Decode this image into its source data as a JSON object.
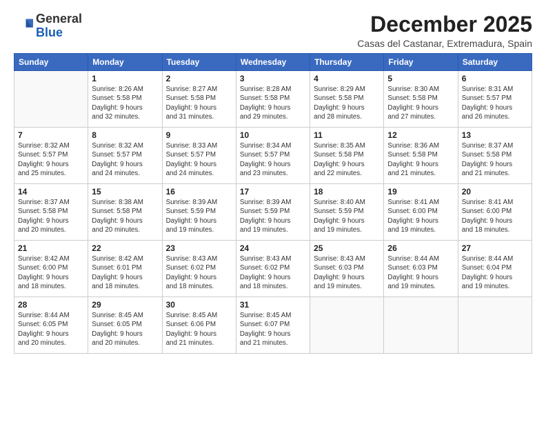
{
  "logo": {
    "line1": "General",
    "line2": "Blue"
  },
  "title": "December 2025",
  "location": "Casas del Castanar, Extremadura, Spain",
  "headers": [
    "Sunday",
    "Monday",
    "Tuesday",
    "Wednesday",
    "Thursday",
    "Friday",
    "Saturday"
  ],
  "weeks": [
    [
      {
        "day": "",
        "info": ""
      },
      {
        "day": "1",
        "info": "Sunrise: 8:26 AM\nSunset: 5:58 PM\nDaylight: 9 hours\nand 32 minutes."
      },
      {
        "day": "2",
        "info": "Sunrise: 8:27 AM\nSunset: 5:58 PM\nDaylight: 9 hours\nand 31 minutes."
      },
      {
        "day": "3",
        "info": "Sunrise: 8:28 AM\nSunset: 5:58 PM\nDaylight: 9 hours\nand 29 minutes."
      },
      {
        "day": "4",
        "info": "Sunrise: 8:29 AM\nSunset: 5:58 PM\nDaylight: 9 hours\nand 28 minutes."
      },
      {
        "day": "5",
        "info": "Sunrise: 8:30 AM\nSunset: 5:58 PM\nDaylight: 9 hours\nand 27 minutes."
      },
      {
        "day": "6",
        "info": "Sunrise: 8:31 AM\nSunset: 5:57 PM\nDaylight: 9 hours\nand 26 minutes."
      }
    ],
    [
      {
        "day": "7",
        "info": "Sunrise: 8:32 AM\nSunset: 5:57 PM\nDaylight: 9 hours\nand 25 minutes."
      },
      {
        "day": "8",
        "info": "Sunrise: 8:32 AM\nSunset: 5:57 PM\nDaylight: 9 hours\nand 24 minutes."
      },
      {
        "day": "9",
        "info": "Sunrise: 8:33 AM\nSunset: 5:57 PM\nDaylight: 9 hours\nand 24 minutes."
      },
      {
        "day": "10",
        "info": "Sunrise: 8:34 AM\nSunset: 5:57 PM\nDaylight: 9 hours\nand 23 minutes."
      },
      {
        "day": "11",
        "info": "Sunrise: 8:35 AM\nSunset: 5:58 PM\nDaylight: 9 hours\nand 22 minutes."
      },
      {
        "day": "12",
        "info": "Sunrise: 8:36 AM\nSunset: 5:58 PM\nDaylight: 9 hours\nand 21 minutes."
      },
      {
        "day": "13",
        "info": "Sunrise: 8:37 AM\nSunset: 5:58 PM\nDaylight: 9 hours\nand 21 minutes."
      }
    ],
    [
      {
        "day": "14",
        "info": "Sunrise: 8:37 AM\nSunset: 5:58 PM\nDaylight: 9 hours\nand 20 minutes."
      },
      {
        "day": "15",
        "info": "Sunrise: 8:38 AM\nSunset: 5:58 PM\nDaylight: 9 hours\nand 20 minutes."
      },
      {
        "day": "16",
        "info": "Sunrise: 8:39 AM\nSunset: 5:59 PM\nDaylight: 9 hours\nand 19 minutes."
      },
      {
        "day": "17",
        "info": "Sunrise: 8:39 AM\nSunset: 5:59 PM\nDaylight: 9 hours\nand 19 minutes."
      },
      {
        "day": "18",
        "info": "Sunrise: 8:40 AM\nSunset: 5:59 PM\nDaylight: 9 hours\nand 19 minutes."
      },
      {
        "day": "19",
        "info": "Sunrise: 8:41 AM\nSunset: 6:00 PM\nDaylight: 9 hours\nand 19 minutes."
      },
      {
        "day": "20",
        "info": "Sunrise: 8:41 AM\nSunset: 6:00 PM\nDaylight: 9 hours\nand 18 minutes."
      }
    ],
    [
      {
        "day": "21",
        "info": "Sunrise: 8:42 AM\nSunset: 6:00 PM\nDaylight: 9 hours\nand 18 minutes."
      },
      {
        "day": "22",
        "info": "Sunrise: 8:42 AM\nSunset: 6:01 PM\nDaylight: 9 hours\nand 18 minutes."
      },
      {
        "day": "23",
        "info": "Sunrise: 8:43 AM\nSunset: 6:02 PM\nDaylight: 9 hours\nand 18 minutes."
      },
      {
        "day": "24",
        "info": "Sunrise: 8:43 AM\nSunset: 6:02 PM\nDaylight: 9 hours\nand 18 minutes."
      },
      {
        "day": "25",
        "info": "Sunrise: 8:43 AM\nSunset: 6:03 PM\nDaylight: 9 hours\nand 19 minutes."
      },
      {
        "day": "26",
        "info": "Sunrise: 8:44 AM\nSunset: 6:03 PM\nDaylight: 9 hours\nand 19 minutes."
      },
      {
        "day": "27",
        "info": "Sunrise: 8:44 AM\nSunset: 6:04 PM\nDaylight: 9 hours\nand 19 minutes."
      }
    ],
    [
      {
        "day": "28",
        "info": "Sunrise: 8:44 AM\nSunset: 6:05 PM\nDaylight: 9 hours\nand 20 minutes."
      },
      {
        "day": "29",
        "info": "Sunrise: 8:45 AM\nSunset: 6:05 PM\nDaylight: 9 hours\nand 20 minutes."
      },
      {
        "day": "30",
        "info": "Sunrise: 8:45 AM\nSunset: 6:06 PM\nDaylight: 9 hours\nand 21 minutes."
      },
      {
        "day": "31",
        "info": "Sunrise: 8:45 AM\nSunset: 6:07 PM\nDaylight: 9 hours\nand 21 minutes."
      },
      {
        "day": "",
        "info": ""
      },
      {
        "day": "",
        "info": ""
      },
      {
        "day": "",
        "info": ""
      }
    ]
  ]
}
